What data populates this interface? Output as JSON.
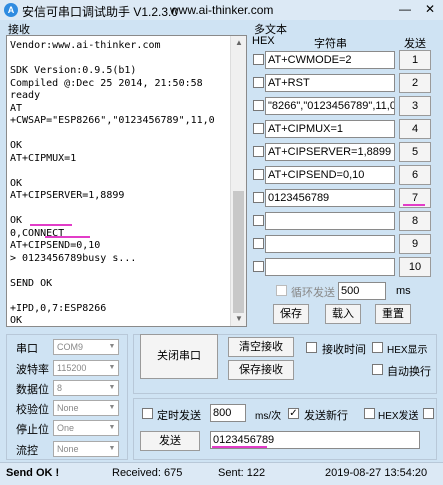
{
  "window": {
    "title": "安信可串口调试助手 V1.2.3.0",
    "url": "www.ai-thinker.com",
    "minimize": "—",
    "close": "✕"
  },
  "receive": {
    "label": "接收",
    "text": "Vendor:www.ai-thinker.com\n\nSDK Version:0.9.5(b1)\nCompiled @:Dec 25 2014, 21:50:58\nready\nAT\n+CWSAP=\"ESP8266\",\"0123456789\",11,0\n\nOK\nAT+CIPMUX=1\n\nOK\nAT+CIPSERVER=1,8899\n\nOK\n0,CONNECT\nAT+CIPSEND=0,10\n> 0123456789busy s...\n\nSEND OK\n\n+IPD,0,7:ESP8266\nOK"
  },
  "multi": {
    "label": "多文本",
    "col_hex": "HEX",
    "col_str": "字符串",
    "col_send": "发送",
    "rows": [
      {
        "text": "AT+CWMODE=2",
        "num": "1"
      },
      {
        "text": "AT+RST",
        "num": "2"
      },
      {
        "text": "\"8266\",\"0123456789\",11,0",
        "num": "3"
      },
      {
        "text": "AT+CIPMUX=1",
        "num": "4"
      },
      {
        "text": "AT+CIPSERVER=1,8899",
        "num": "5"
      },
      {
        "text": "AT+CIPSEND=0,10",
        "num": "6"
      },
      {
        "text": "0123456789",
        "num": "7"
      },
      {
        "text": "",
        "num": "8"
      },
      {
        "text": "",
        "num": "9"
      },
      {
        "text": "",
        "num": "10"
      }
    ],
    "loop_label": "循环发送",
    "loop_value": "500",
    "ms": "ms",
    "save": "保存",
    "load": "载入",
    "reset": "重置"
  },
  "serial": {
    "port_label": "串口",
    "port_value": "COM9",
    "baud_label": "波特率",
    "baud_value": "115200",
    "data_label": "数据位",
    "data_value": "8",
    "parity_label": "校验位",
    "parity_value": "None",
    "stop_label": "停止位",
    "stop_value": "One",
    "flow_label": "流控",
    "flow_value": "None"
  },
  "controls": {
    "close_port": "关闭串口",
    "clear_recv": "清空接收",
    "save_recv": "保存接收",
    "recv_time": "接收时间",
    "hex_display": "HEX显示",
    "auto_wrap": "自动换行"
  },
  "send": {
    "timed_send": "定时发送",
    "interval": "800",
    "unit": "ms/次",
    "send_newline": "发送新行",
    "hex_send": "HEX发送",
    "send_button": "发送",
    "input_value": "0123456789"
  },
  "status": {
    "message": "Send OK !",
    "received": "Received: 675",
    "sent": "Sent: 122",
    "datetime": "2019-08-27 13:54:20"
  }
}
